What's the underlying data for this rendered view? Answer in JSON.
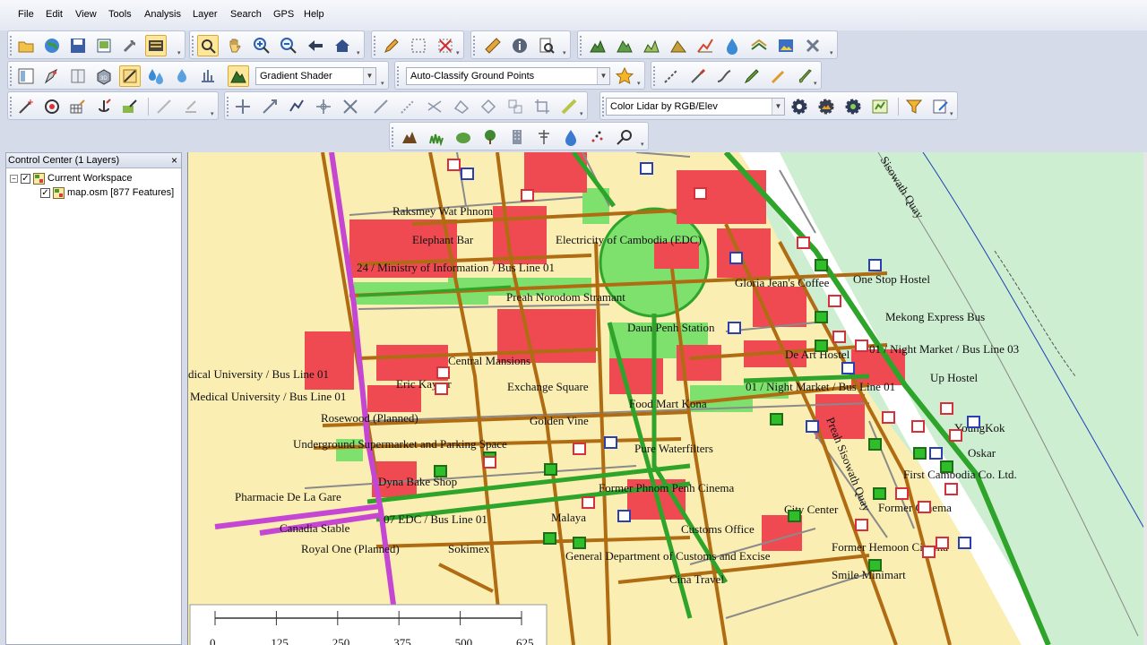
{
  "menu": [
    "File",
    "Edit",
    "View",
    "Tools",
    "Analysis",
    "Layer",
    "Search",
    "GPS",
    "Help"
  ],
  "toolbar": {
    "gradient_shader": "Gradient Shader",
    "auto_classify": "Auto-Classify Ground Points",
    "color_lidar": "Color Lidar by RGB/Elev"
  },
  "control_center": {
    "title": "Control Center (1 Layers)",
    "close": "×",
    "workspace": "Current Workspace",
    "layer": "map.osm [877 Features]"
  },
  "map": {
    "labels": [
      "Raksmey Wat Phnom",
      "Elephant Bar",
      "Electricity of Cambodia (EDC)",
      "24 / Ministry of Information / Bus Line 01",
      "Preah Norodom Stramant",
      "Daun Penh Station",
      "Central Mansions",
      "dical University / Bus Line 01",
      "Medical University / Bus Line 01",
      "Eric Kayser",
      "Exchange Square",
      "Rosewood (Planned)",
      "Golden Vine",
      "Food Mart Kona",
      "Underground Supermarket and Parking Space",
      "Pure Waterfilters",
      "Dyna Bake Shop",
      "Pharmacie De La Gare",
      "Canadia Stable",
      "Royal One (Planned)",
      "07 EDC / Bus Line 01",
      "Malaya",
      "Sokimex",
      "Former Phnom Penh Cinema",
      "General Department of Customs and Excise",
      "Customs Office",
      "Cina Travel",
      "City Center",
      "Former Hemoon Cinema",
      "Smile Minimart",
      "Former Cinema",
      "First Cambodia Co. Ltd.",
      "Oskar",
      "YoungKok",
      "Gloria Jean's Coffee",
      "One Stop Hostel",
      "Mekong Express Bus",
      "01 / Night Market / Bus Line 03",
      "De Art Hostel",
      "Up Hostel",
      "01 / Night Market / Bus Line 01",
      "Sisowath Quay",
      "Preah Sisowath Quay"
    ],
    "scale_ticks": [
      "0",
      "125",
      "250",
      "375",
      "500",
      "625"
    ]
  },
  "icons": {
    "open": "open-folder-icon",
    "globe": "globe-icon",
    "save": "save-icon",
    "zoom_in": "zoom-in-icon",
    "zoom_out": "zoom-out-icon",
    "home": "home-icon",
    "info": "info-icon",
    "pan": "pan-hand-icon"
  },
  "colors": {
    "map_bg": "#fbeeb3",
    "building": "#ef4a52",
    "park": "#7ee06d",
    "major_road": "#b06c13",
    "primary_road": "#2fa42a",
    "trunk_road": "#c646d4",
    "river_bank": "#cdeed1"
  }
}
